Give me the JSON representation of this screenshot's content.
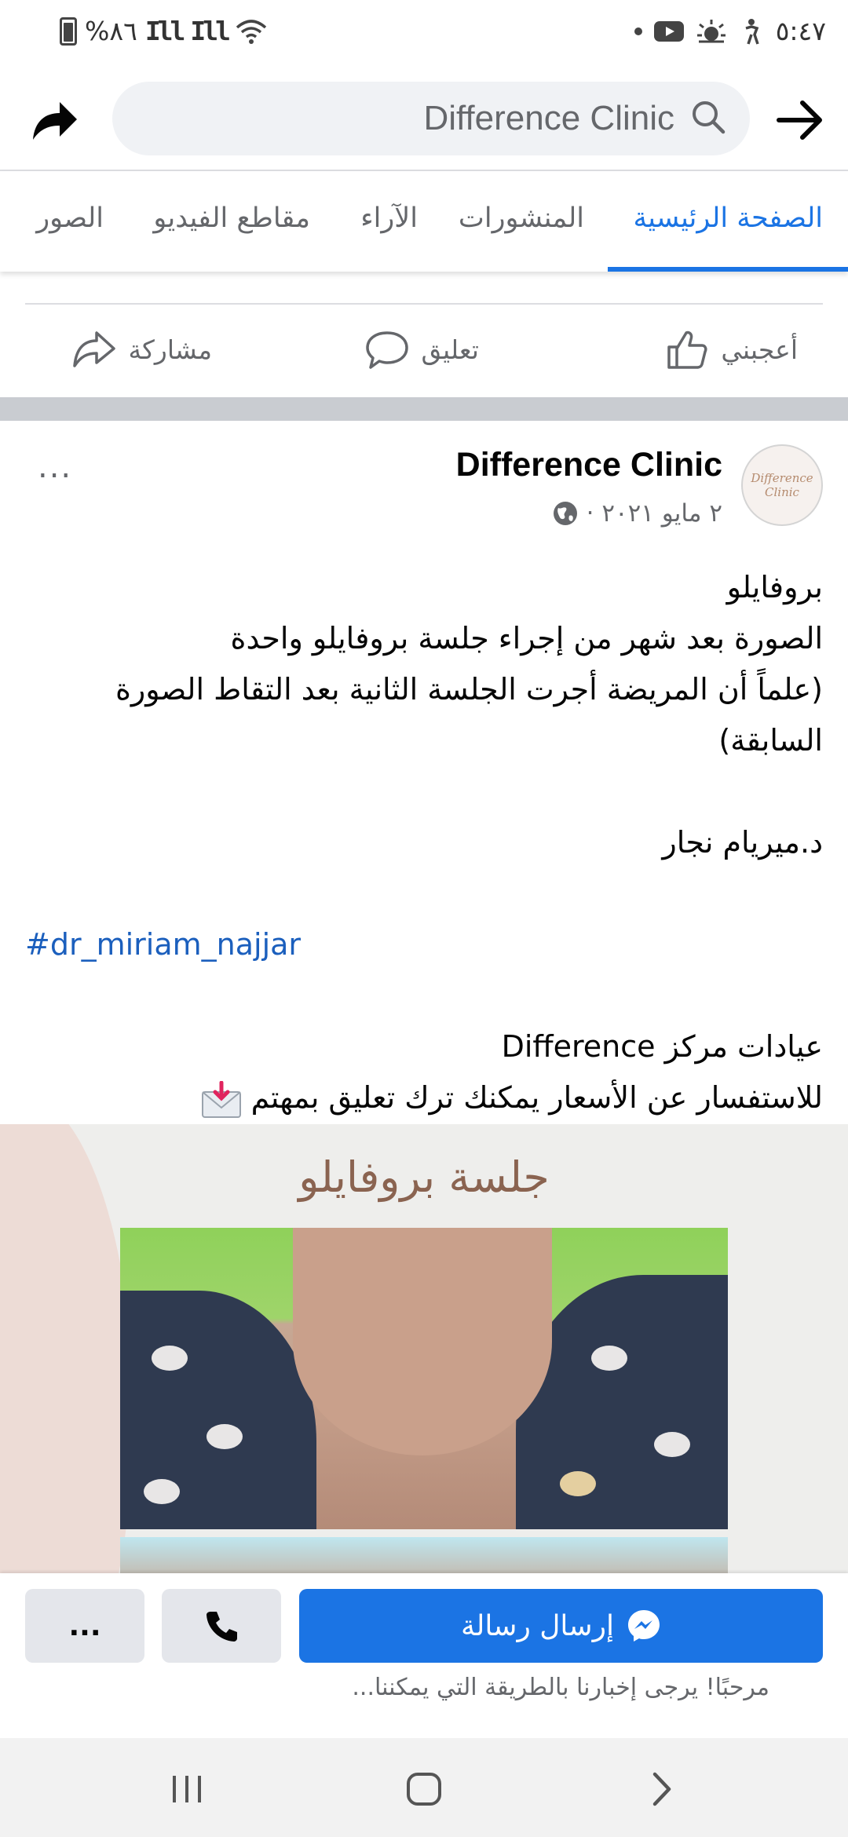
{
  "status_bar": {
    "battery": "%٨٦",
    "time": "٥:٤٧"
  },
  "header": {
    "search_text": "Difference Clinic"
  },
  "tabs": [
    {
      "label": "الصفحة الرئيسية",
      "active": true
    },
    {
      "label": "المنشورات",
      "active": false
    },
    {
      "label": "الآراء",
      "active": false
    },
    {
      "label": "مقاطع الفيديو",
      "active": false
    },
    {
      "label": "الصور",
      "active": false
    }
  ],
  "reactions": {
    "like": "أعجبني",
    "comment": "تعليق",
    "share": "مشاركة"
  },
  "post": {
    "page_name": "Difference Clinic",
    "avatar_text": "Difference Clinic",
    "date": "٢ مايو ٢٠٢١ ·",
    "lines": [
      "بروفايلو",
      "الصورة بعد شهر من إجراء جلسة بروفايلو واحدة",
      "(علماً أن المريضة أجرت الجلسة الثانية بعد التقاط الصورة",
      "السابقة)",
      "",
      "د.ميريام نجار",
      ""
    ],
    "hashtag": "#dr_miriam_najjar",
    "lines_after": [
      "",
      "عيادات مركز Difference",
      "للاستفسار عن الأسعار يمكنك ترك تعليق بمهتم"
    ],
    "image_title": "جلسة بروفايلو"
  },
  "actions": {
    "send_message": "إرسال رسالة",
    "more": "...",
    "welcome": "مرحبًا! يرجى إخبارنا بالطريقة التي يمكننا..."
  },
  "colors": {
    "accent": "#1b74e4",
    "hashtag": "#1b5fbd",
    "secondary_text": "#65676b"
  }
}
